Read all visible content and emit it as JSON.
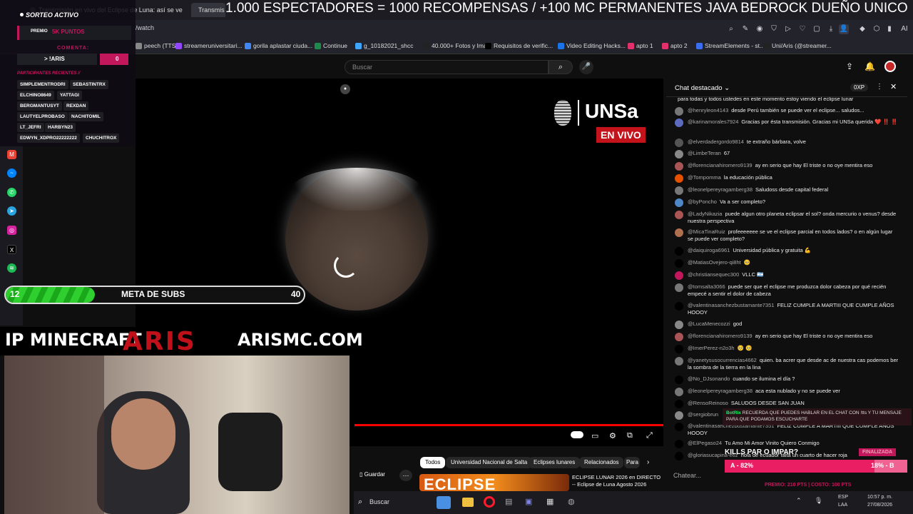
{
  "tabs": {
    "tab1": "Transmisión en vivo del Eclipse de Luna: así se ve",
    "tab2": "Transmis",
    "marquee": "1.000 ESPECTADORES = 1000 RECOMPENSAS / +100 MC PERMANENTES JAVA BEDROCK DUEÑO UNICO"
  },
  "address": {
    "url": "/watch"
  },
  "bookmarks": [
    "peech (TTS...",
    "streameruniversitari...",
    "gorila aplastar ciuda...",
    "Continue",
    "g_10182021_shcc",
    "40.000+ Fotos y Imá...",
    "Requisitos de verific...",
    "Video Editing Hacks...",
    "apto 1",
    "apto 2",
    "StreamElements - st...",
    "Uni/Aris (@streamer..."
  ],
  "bookmark_colors": [
    "#888",
    "#9146ff",
    "#4285f4",
    "#1e8a4c",
    "#3ea6ff",
    "#222",
    "#000",
    "#1a73e8",
    "#e1306c",
    "#e1306c",
    "#3b6df0",
    "#222"
  ],
  "yt": {
    "search_placeholder": "Buscar"
  },
  "video": {
    "logo_text": "UNSa",
    "live_badge": "EN VIVO",
    "progress": 1.0
  },
  "chat": {
    "title": "Chat destacado",
    "points": "0XP",
    "input_placeholder": "Chatear...",
    "messages": [
      {
        "author": "",
        "text": "para todas y todos ustedes en este momento estoy viendo el eclipse lunar",
        "color": "#000"
      },
      {
        "author": "@henryleon4143",
        "text": "desde Perú también se puede ver el eclipse... saludos...",
        "color": "#777"
      },
      {
        "author": "@karinamorales7924",
        "text": "Gracias por ésta transmisión. Gracias mi UNSa querida ❤️ ‼️ ‼️",
        "color": "#5c6bc0"
      },
      {
        "author": "@elverdadergordo9814",
        "text": "te extraño bárbara, volve",
        "color": "#555"
      },
      {
        "author": "@LimbeTeran",
        "text": "67",
        "color": "#888"
      },
      {
        "author": "@florencianahiromero9139",
        "text": "ay en serio que hay El triste o no oye mentira eso",
        "color": "#a55"
      },
      {
        "author": "@Tompomma",
        "text": "la educación pública",
        "color": "#e65100"
      },
      {
        "author": "@leonelpereyragamberg38",
        "text": "Saludoss desde capital federal",
        "color": "#777"
      },
      {
        "author": "@byPoncho",
        "text": "Va a ser completo?",
        "color": "#4e88c7"
      },
      {
        "author": "@LadyNikazia",
        "text": "puede algun otro planeta eclipsar el sol? onda mercurio o venus? desde nuestra perspectiva",
        "color": "#a55"
      },
      {
        "author": "@MicaTinaRuiz",
        "text": "profeeeeeee se ve el eclipse parcial en todos lados? o en algún lugar se puede ver completo?",
        "color": "#b07050"
      },
      {
        "author": "@daiquiroga6961",
        "text": "Universidad pública y gratuita 💪",
        "color": "#000"
      },
      {
        "author": "@MatiasOvejero-qi8ht",
        "text": "🥺",
        "color": "#000"
      },
      {
        "author": "@christiansequec300",
        "text": "VLLC 🇦🇷",
        "color": "#c2185b"
      },
      {
        "author": "@tomsalta3066",
        "text": "puede ser que el eclipse me produzca dolor cabeza por qué recién empecé a sentir el dolor de cabeza",
        "color": "#777"
      },
      {
        "author": "@valentinasanchezbustamante7351",
        "text": "FELIZ CUMPLE A MARTIII QUE CUMPLE AÑOS HOOOY",
        "color": "#000"
      },
      {
        "author": "@LucaMenecozzi",
        "text": "god",
        "color": "#888"
      },
      {
        "author": "@florencianahiromero9139",
        "text": "ay en serio que hay El triste o no oye mentira eso",
        "color": "#a55"
      },
      {
        "author": "@ImerPerez-n2o3h",
        "text": "🥺 🥺",
        "color": "#000"
      },
      {
        "author": "@yanetysusocurrencias4662",
        "text": "quien. ba acrer que desde ac de nuestra cas podemos ber la sombra de la tierra en la lina",
        "color": "#777"
      },
      {
        "author": "@No_DJsonando",
        "text": "cuando se ilumina el día ?",
        "color": "#000"
      },
      {
        "author": "@leonelpereyragamberg38",
        "text": "aca esta nublado y no se puede ver",
        "color": "#777"
      },
      {
        "author": "@RensoReinoso",
        "text": "SALUDOS DESDE SAN JUAN",
        "color": "#000"
      },
      {
        "author": "@sergiobrun",
        "text": "",
        "color": "#888"
      },
      {
        "author": "@valentinasanchezbustamante7351",
        "text": "FELIZ CUMPLE A MARTIII QUE CUMPLE AÑOS HOOOY",
        "color": "#000"
      },
      {
        "author": "@ElPegaso24",
        "text": "Tu Amo Mi Amor Vinito Quiero Conmigo",
        "color": "#000"
      },
      {
        "author": "@gloriasucapina-e6z",
        "text": "hola de ecuador falta un cuarto de hacer roja",
        "color": "#000"
      }
    ]
  },
  "sorteo": {
    "title": "SORTEO ACTIVO",
    "prize_label": "PREMIO",
    "prize_value": "5K PUNTOS",
    "comment_label": "COMENTA:",
    "command": "> !ARIS",
    "count": "0",
    "participants_label": "PARTICIPANTES RECIENTES //",
    "participants": [
      "SIMPLEMENTRODRI",
      "SEBASTINTRX",
      "ELCHINO8649",
      "YATTAGI",
      "BERGMANTUSYT",
      "REXDAN",
      "LAUTYELPROBASO",
      "NACHITOMIL",
      "LT_JEFRI",
      "HARBYN23",
      "EDWYN_XDPRO22222222",
      "CHUCHITROX"
    ]
  },
  "meta": {
    "current": "12",
    "label": "META DE SUBS",
    "goal": "40",
    "progress": 0.3
  },
  "ip": {
    "prefix": "IP MINECRAFT",
    "brand": "ARIS",
    "domain": "ARISMC.COM"
  },
  "below": {
    "chips": [
      "Todos",
      "Universidad Nacional de Salta",
      "Eclipses lunares",
      "Relacionados",
      "Para"
    ],
    "save_label": "Guardar",
    "card_title": "ECLIPSE LUNAR 2026 en DIRECTO -- Eclipse de Luna Agosto 2026",
    "thumb_text": "ECLIPSE"
  },
  "botrix": {
    "name": "BotRix",
    "text": "RECUERDA QUE PUEDES HABLAR EN EL CHAT CON !tts Y TU MENSAJE PARA QUE PODAMOS ESCUCHARTE"
  },
  "kills": {
    "title": "KILLS PAR O IMPAR?",
    "status": "FINALIZADA",
    "option_a": "A - 82%",
    "option_b": "18% - B",
    "prize": "PREMIO: 210 PTS | COSTO: 100 PTS"
  },
  "taskbar": {
    "search": "Buscar",
    "lang1": "ESP",
    "lang2": "LAA",
    "time": "10:57 p. m.",
    "date": "27/08/2026"
  }
}
